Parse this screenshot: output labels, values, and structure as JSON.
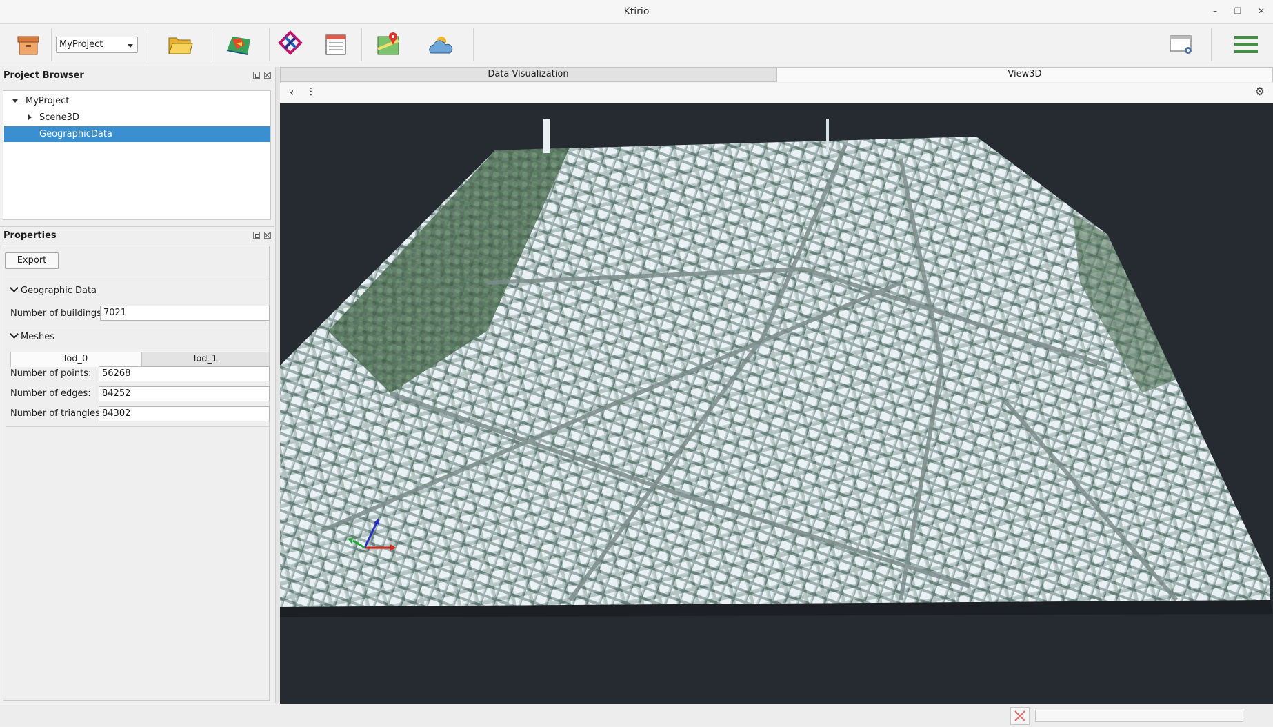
{
  "window": {
    "title": "Ktirio"
  },
  "toolbar": {
    "project_selected": "MyProject",
    "icons": [
      "archive-box-icon",
      "open-folder-icon",
      "terrain-map-icon",
      "ifc-logo-icon",
      "calendar-icon",
      "map-pin-icon",
      "weather-icon",
      "window-settings-icon",
      "hamburger-menu-icon"
    ]
  },
  "project_browser": {
    "title": "Project Browser",
    "items": [
      {
        "label": "MyProject"
      },
      {
        "label": "Scene3D"
      },
      {
        "label": "GeographicData"
      }
    ]
  },
  "properties": {
    "title": "Properties",
    "export_label": "Export",
    "geo_section": "Geographic Data",
    "buildings_label": "Number of buildings:",
    "buildings_value": "7021",
    "meshes_section": "Meshes",
    "lod_tabs": [
      "lod_0",
      "lod_1"
    ],
    "points_label": "Number of points:",
    "points_value": "56268",
    "edges_label": "Number of edges:",
    "edges_value": "84252",
    "triangles_label": "Number of triangles:",
    "triangles_value": "84302"
  },
  "view_tabs": [
    "Data Visualization",
    "View3D"
  ],
  "viewbar": {
    "back_glyph": "‹",
    "more_glyph": "⋮",
    "settings_glyph": "⚙"
  },
  "colors": {
    "selection": "#3a8fd0",
    "viewport_bg": "#262b31",
    "terrain": "#6f8a80",
    "buildings": "#e4eef2"
  }
}
